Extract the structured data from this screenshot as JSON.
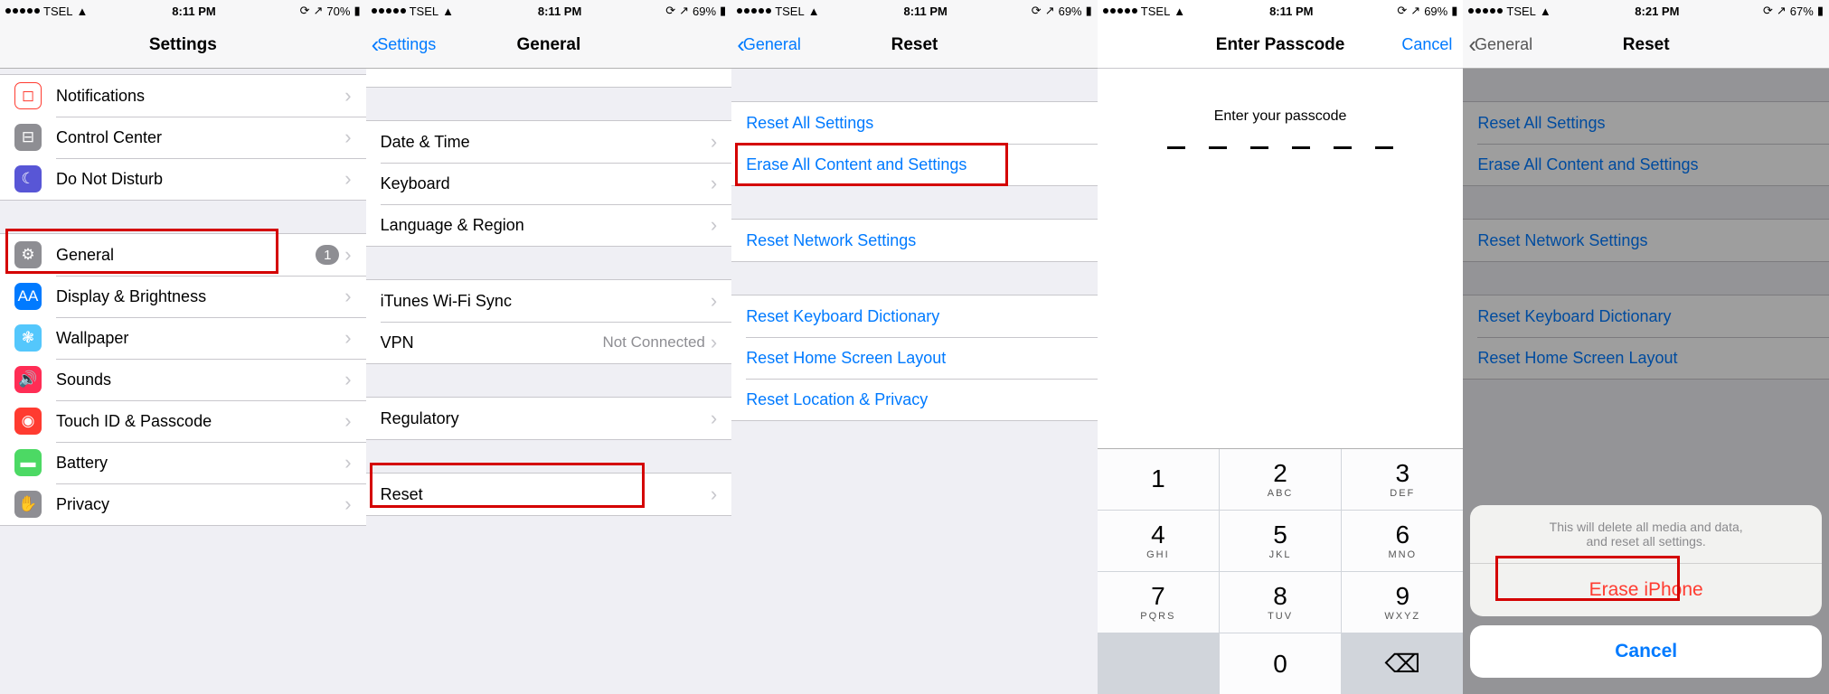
{
  "status": {
    "carrier": "TSEL",
    "time1": "8:11 PM",
    "time5": "8:21 PM",
    "b1": "70%",
    "b2": "69%",
    "b5": "67%",
    "loc": "↗"
  },
  "s1": {
    "title": "Settings",
    "items": [
      {
        "label": "Notifications"
      },
      {
        "label": "Control Center"
      },
      {
        "label": "Do Not Disturb"
      },
      {
        "label": "General",
        "badge": "1"
      },
      {
        "label": "Display & Brightness"
      },
      {
        "label": "Wallpaper"
      },
      {
        "label": "Sounds"
      },
      {
        "label": "Touch ID & Passcode"
      },
      {
        "label": "Battery"
      },
      {
        "label": "Privacy"
      }
    ]
  },
  "s2": {
    "back": "Settings",
    "title": "General",
    "items": [
      {
        "label": "Date & Time"
      },
      {
        "label": "Keyboard"
      },
      {
        "label": "Language & Region"
      },
      {
        "label": "iTunes Wi-Fi Sync"
      },
      {
        "label": "VPN",
        "value": "Not Connected"
      },
      {
        "label": "Regulatory"
      },
      {
        "label": "Reset"
      }
    ]
  },
  "s3": {
    "back": "General",
    "title": "Reset",
    "items": [
      {
        "label": "Reset All Settings"
      },
      {
        "label": "Erase All Content and Settings"
      },
      {
        "label": "Reset Network Settings"
      },
      {
        "label": "Reset Keyboard Dictionary"
      },
      {
        "label": "Reset Home Screen Layout"
      },
      {
        "label": "Reset Location & Privacy"
      }
    ]
  },
  "s4": {
    "title": "Enter Passcode",
    "cancel": "Cancel",
    "msg": "Enter your passcode",
    "keys": [
      {
        "n": "1",
        "l": ""
      },
      {
        "n": "2",
        "l": "ABC"
      },
      {
        "n": "3",
        "l": "DEF"
      },
      {
        "n": "4",
        "l": "GHI"
      },
      {
        "n": "5",
        "l": "JKL"
      },
      {
        "n": "6",
        "l": "MNO"
      },
      {
        "n": "7",
        "l": "PQRS"
      },
      {
        "n": "8",
        "l": "TUV"
      },
      {
        "n": "9",
        "l": "WXYZ"
      },
      {
        "n": "",
        "l": ""
      },
      {
        "n": "0",
        "l": ""
      },
      {
        "n": "⌫",
        "l": ""
      }
    ]
  },
  "s5": {
    "back": "General",
    "title": "Reset",
    "sheet": {
      "msg": "This will delete all media and data,\nand reset all settings.",
      "erase": "Erase iPhone",
      "cancel": "Cancel"
    }
  }
}
